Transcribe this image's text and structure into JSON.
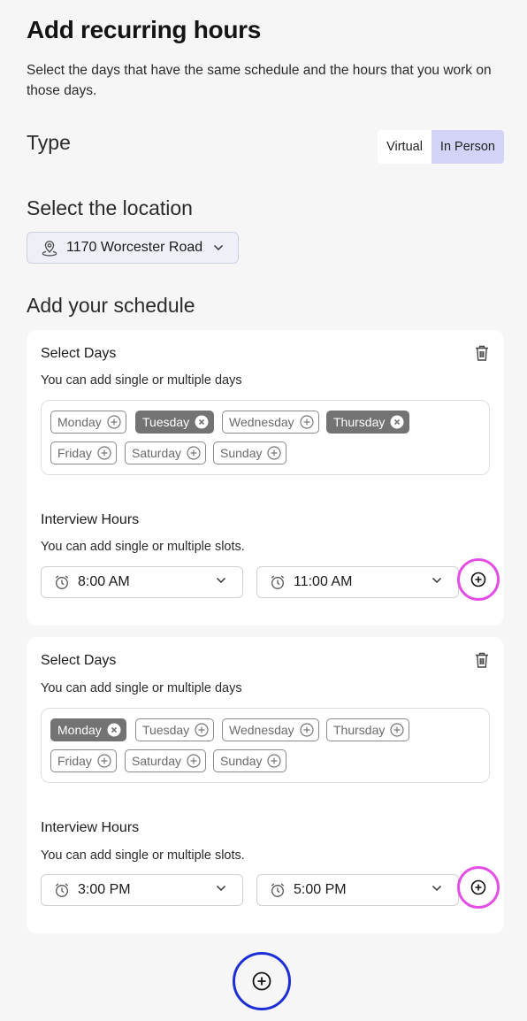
{
  "page": {
    "title": "Add recurring hours",
    "subtitle": "Select the days that have the same schedule and the hours that you work on those days."
  },
  "type_section": {
    "heading": "Type",
    "options": [
      "Virtual",
      "In Person"
    ],
    "selected": "In Person"
  },
  "location_section": {
    "heading": "Select the location",
    "selected_location": "1170 Worcester Road"
  },
  "schedule_section": {
    "heading": "Add your schedule",
    "cards": [
      {
        "days_title": "Select Days",
        "days_hint": "You can add single or multiple days",
        "days": [
          {
            "label": "Monday",
            "selected": false
          },
          {
            "label": "Tuesday",
            "selected": true
          },
          {
            "label": "Wednesday",
            "selected": false
          },
          {
            "label": "Thursday",
            "selected": true
          },
          {
            "label": "Friday",
            "selected": false
          },
          {
            "label": "Saturday",
            "selected": false
          },
          {
            "label": "Sunday",
            "selected": false
          }
        ],
        "hours_title": "Interview Hours",
        "hours_hint": "You can add single or multiple slots.",
        "start_time": "8:00 AM",
        "end_time": "11:00 AM"
      },
      {
        "days_title": "Select Days",
        "days_hint": "You can add single or multiple days",
        "days": [
          {
            "label": "Monday",
            "selected": true
          },
          {
            "label": "Tuesday",
            "selected": false
          },
          {
            "label": "Wednesday",
            "selected": false
          },
          {
            "label": "Thursday",
            "selected": false
          },
          {
            "label": "Friday",
            "selected": false
          },
          {
            "label": "Saturday",
            "selected": false
          },
          {
            "label": "Sunday",
            "selected": false
          }
        ],
        "hours_title": "Interview Hours",
        "hours_hint": "You can add single or multiple slots.",
        "start_time": "3:00 PM",
        "end_time": "5:00 PM"
      }
    ]
  },
  "icons": {
    "location": "location-pin-icon",
    "chevron": "chevron-down-icon",
    "trash": "trash-icon",
    "clock": "alarm-clock-icon",
    "add": "plus-circle-icon",
    "remove": "x-circle-icon"
  },
  "colors": {
    "toggle_active": "#d3d3f8",
    "chip_selected": "#737373",
    "add_slot_ring": "#e44ee4",
    "add_schedule_ring": "#1c2ed6"
  }
}
